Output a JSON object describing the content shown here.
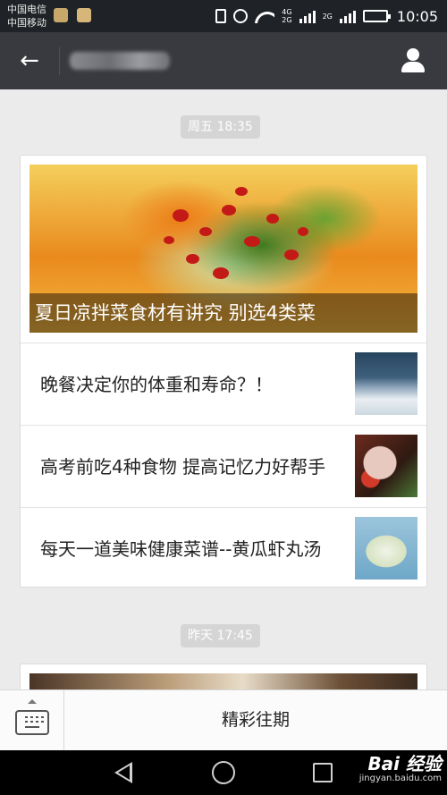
{
  "status_bar": {
    "carriers": [
      "中国电信",
      "中国移动"
    ],
    "network_labels": [
      "4G",
      "2G",
      "2G"
    ],
    "time": "10:05",
    "battery_color": "#42c243"
  },
  "title_bar": {
    "back_icon": "arrow-left-icon",
    "profile_icon": "person-icon"
  },
  "messages": [
    {
      "time": "周五 18:35",
      "cover_title": "夏日凉拌菜食材有讲究 别选4类菜",
      "items": [
        {
          "title": "晚餐决定你的体重和寿命？！"
        },
        {
          "title": "高考前吃4种食物 提高记忆力好帮手"
        },
        {
          "title": "每天一道美味健康菜谱--黄瓜虾丸汤"
        }
      ]
    },
    {
      "time": "昨天 17:45"
    }
  ],
  "bottom_menu": {
    "keyboard_icon": "keyboard-icon",
    "menu_label": "精彩往期"
  },
  "watermark": {
    "main": "Bai 经验",
    "sub": "jingyan.baidu.com"
  }
}
